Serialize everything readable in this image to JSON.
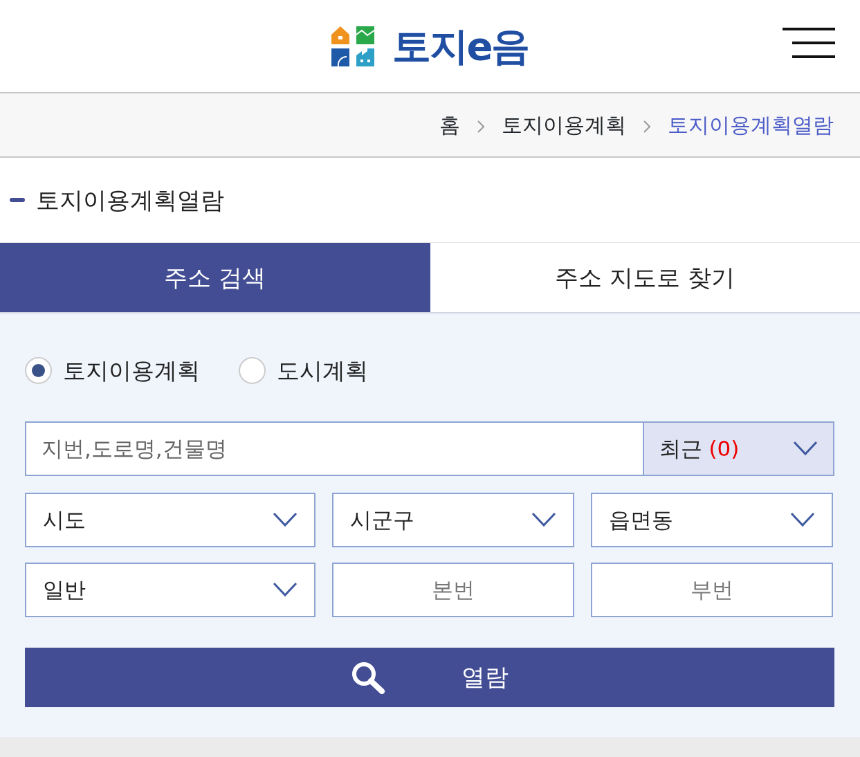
{
  "header": {
    "logo_text": "토지e음"
  },
  "breadcrumb": [
    {
      "label": "홈",
      "selected": false
    },
    {
      "label": "토지이용계획",
      "selected": false
    },
    {
      "label": "토지이용계획열람",
      "selected": true
    }
  ],
  "page_title": "토지이용계획열람",
  "tabs": [
    {
      "label": "주소 검색",
      "selected": true
    },
    {
      "label": "주소 지도로 찾기",
      "selected": false
    }
  ],
  "plan_types": [
    {
      "label": "토지이용계획",
      "selected": true
    },
    {
      "label": "도시계획",
      "selected": false
    }
  ],
  "search": {
    "placeholder": "지번,도로명,건물명",
    "recent_label": "최근",
    "recent_count": "(0)"
  },
  "fields": [
    {
      "kind": "select",
      "value": "시도"
    },
    {
      "kind": "select",
      "value": "시군구"
    },
    {
      "kind": "select",
      "value": "읍면동"
    },
    {
      "kind": "select",
      "value": "일반"
    },
    {
      "kind": "input",
      "placeholder": "본번"
    },
    {
      "kind": "input",
      "placeholder": "부번"
    }
  ],
  "submit": {
    "label": "열람"
  }
}
